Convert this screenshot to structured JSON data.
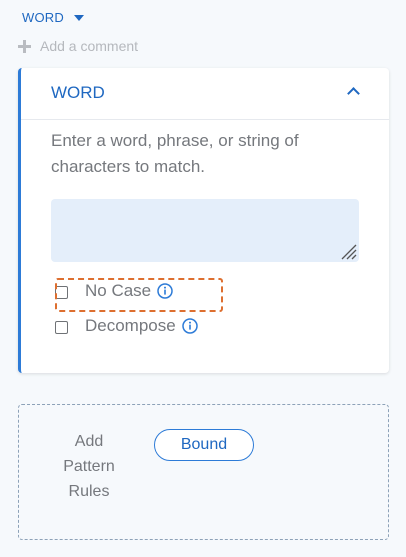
{
  "word_select": {
    "label": "WORD",
    "icon": "caret-down-icon"
  },
  "add_comment": {
    "label": "Add a comment",
    "icon": "plus-icon"
  },
  "card": {
    "title": "WORD",
    "collapse_icon": "chevron-up-icon",
    "description": "Enter a word, phrase, or string of characters to match.",
    "input_value": "",
    "options": [
      {
        "label": "No Case",
        "checked": false,
        "info_icon": "info-icon",
        "focused": true
      },
      {
        "label": "Decompose",
        "checked": false,
        "info_icon": "info-icon",
        "focused": false
      }
    ]
  },
  "pattern_panel": {
    "label": "Add Pattern Rules",
    "button_label": "Bound"
  },
  "colors": {
    "accent": "#1f68c1",
    "card_border": "#2d7bd7",
    "input_fill": "#e4eefa",
    "focus_outline": "#dd6f30",
    "muted_text": "#75787d"
  }
}
